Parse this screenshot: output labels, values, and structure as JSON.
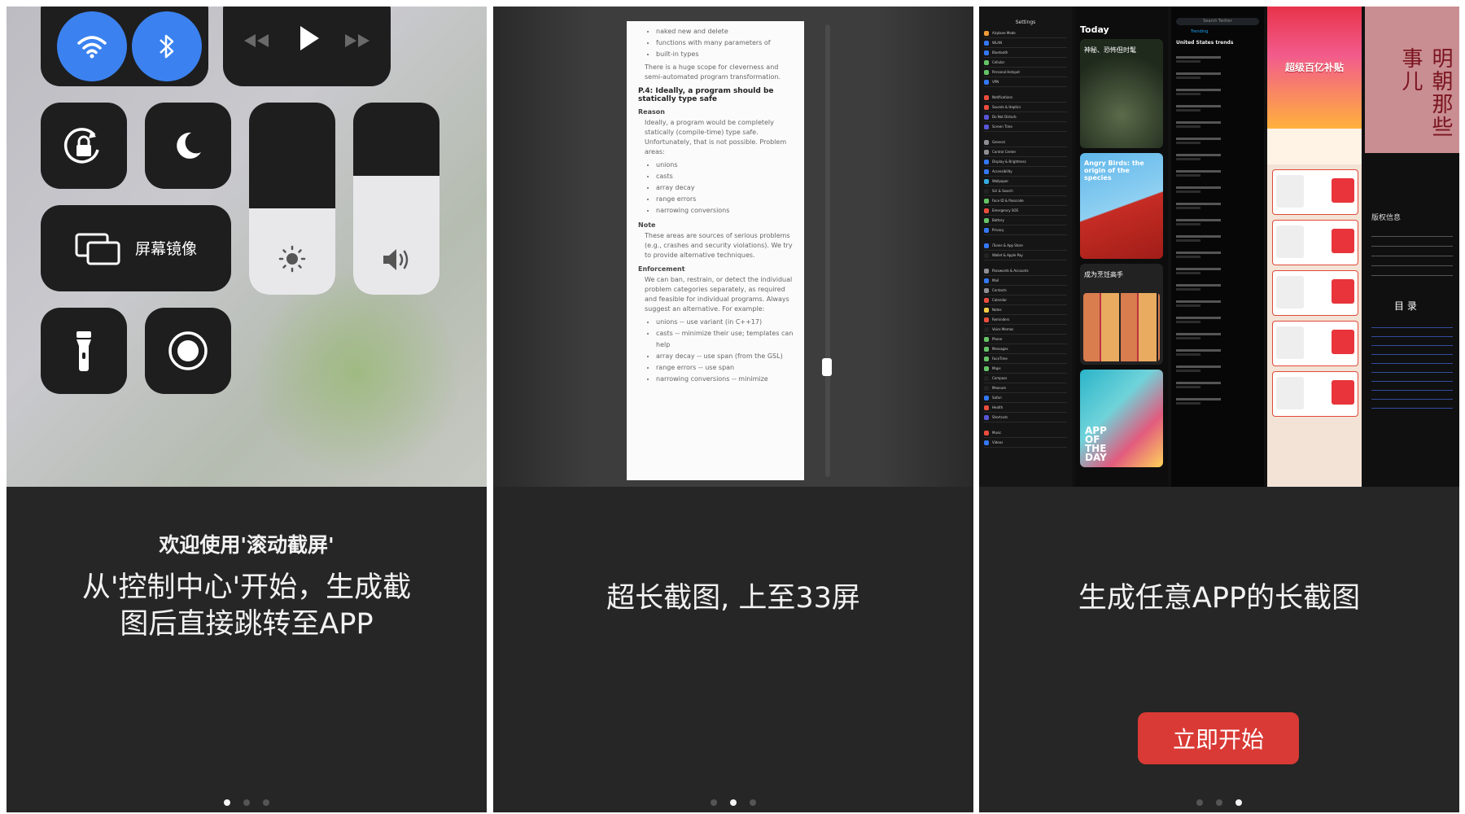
{
  "panel1": {
    "mirror_label": "屏幕镜像",
    "caption_title": "欢迎使用'滚动截屏'",
    "caption_body_line1": "从'控制中心'开始，生成截",
    "caption_body_line2": "图后直接跳转至APP",
    "brightness_level": 0.45,
    "volume_level": 0.62
  },
  "panel2": {
    "doc": {
      "bullets_top": [
        "naked new and delete",
        "functions with many parameters of",
        "built-in types"
      ],
      "intro": "There is a huge scope for cleverness and semi-automated program transformation.",
      "heading": "P.4: Ideally, a program should be statically type safe",
      "reason_label": "Reason",
      "reason_text": "Ideally, a program would be completely statically (compile-time) type safe. Unfortunately, that is not possible. Problem areas:",
      "problem_areas": [
        "unions",
        "casts",
        "array decay",
        "range errors",
        "narrowing conversions"
      ],
      "note_label": "Note",
      "note_text": "These areas are sources of serious problems (e.g., crashes and security violations). We try to provide alternative techniques.",
      "enforcement_label": "Enforcement",
      "enforcement_text": "We can ban, restrain, or detect the individual problem categories separately, as required and feasible for individual programs. Always suggest an alternative. For example:",
      "examples": [
        "unions -- use variant (in C++17)",
        "casts -- minimize their use; templates can help",
        "array decay -- use span (from the GSL)",
        "range errors -- use span",
        "narrowing conversions -- minimize"
      ]
    },
    "caption": "超长截图, 上至33屏"
  },
  "panel3": {
    "caption": "生成任意APP的长截图",
    "start_button": "立即开始",
    "settings": {
      "title": "Settings",
      "items": [
        "Airplane Mode",
        "WLAN",
        "Bluetooth",
        "Cellular",
        "Personal Hotspot",
        "VPN",
        "Notifications",
        "Sounds & Haptics",
        "Do Not Disturb",
        "Screen Time",
        "General",
        "Control Center",
        "Display & Brightness",
        "Accessibility",
        "Wallpaper",
        "Siri & Search",
        "Face ID & Passcode",
        "Emergency SOS",
        "Battery",
        "Privacy",
        "iTunes & App Store",
        "Wallet & Apple Pay",
        "Passwords & Accounts",
        "Mail",
        "Contacts",
        "Calendar",
        "Notes",
        "Reminders",
        "Voice Memos",
        "Phone",
        "Messages",
        "FaceTime",
        "Maps",
        "Compass",
        "Measure",
        "Safari",
        "Health",
        "Shortcuts",
        "Music",
        "Videos"
      ]
    },
    "appstore": {
      "today": "Today",
      "card1": "神秘、恐怖但时髦",
      "card2": "Angry Birds: the origin of the species",
      "card3": "成为烹饪高手",
      "card4": "APP OF THE DAY"
    },
    "twitter": {
      "search": "Search Twitter",
      "tab": "Trending",
      "trends_title": "United States trends"
    },
    "shop": {
      "banner": "超级百亿补贴"
    },
    "book": {
      "title": "明朝那些事儿",
      "rights": "版权信息",
      "toc": "目 录"
    }
  },
  "pager": {
    "count": 3
  }
}
